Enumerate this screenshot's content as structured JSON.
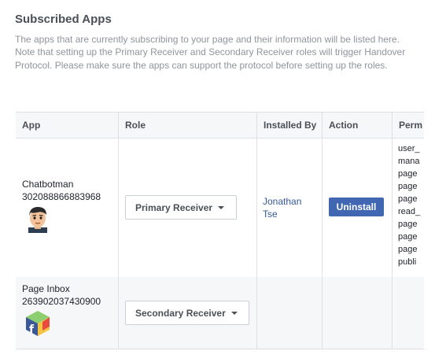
{
  "header": {
    "title": "Subscribed Apps",
    "description": "The apps that are currently subscribing to your page and their information will be listed here. Note that setting up the Primary Receiver and Secondary Receiver roles will trigger Handover Protocol. Please make sure the apps can support the protocol before setting up the roles."
  },
  "table": {
    "columns": [
      "App",
      "Role",
      "Installed By",
      "Action",
      "Perm"
    ],
    "rows": [
      {
        "app_name": "Chatbotman",
        "app_id": "302088866883968",
        "role": "Primary Receiver",
        "installed_by": "Jonathan Tse",
        "action": "Uninstall",
        "permissions": [
          "user_",
          "mana",
          "page",
          "page",
          "page",
          "read_",
          "page",
          "page",
          "page",
          "publi"
        ]
      },
      {
        "app_name": "Page Inbox",
        "app_id": "263902037430900",
        "role": "Secondary Receiver"
      }
    ]
  },
  "colors": {
    "accent": "#4267b2",
    "link": "#365899",
    "border": "#dddfe2"
  },
  "icons": {
    "row1_avatar": "cartoon-man-avatar",
    "row2_avatar": "facebook-cube-icon"
  }
}
